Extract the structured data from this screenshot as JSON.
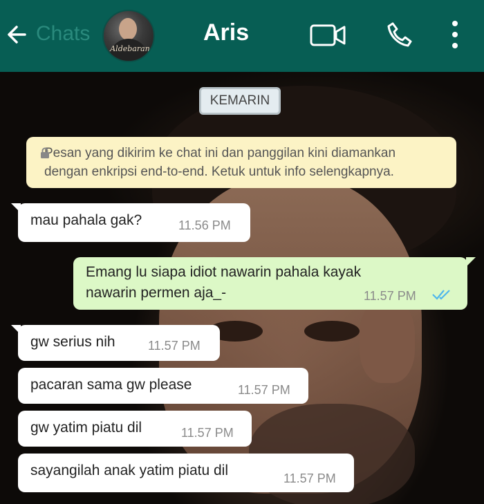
{
  "header": {
    "back_label": "Chats",
    "contact_name": "Aris",
    "avatar_caption": "Aldebaran",
    "icons": [
      "back-arrow-icon",
      "video-call-icon",
      "phone-icon",
      "more-options-icon"
    ]
  },
  "chat": {
    "date_separator": "KEMARIN",
    "encryption_notice": {
      "line1": "Pesan yang dikirim ke chat ini dan panggilan kini diamankan",
      "line2": "dengan enkripsi end-to-end. Ketuk untuk info selengkapnya."
    },
    "messages": [
      {
        "direction": "in",
        "text": "mau pahala gak?",
        "time": "11.56 PM"
      },
      {
        "direction": "out",
        "text_line1": "Emang lu siapa idiot nawarin pahala kayak",
        "text_line2": "nawarin permen aja_-",
        "time": "11.57 PM",
        "status": "read"
      },
      {
        "direction": "in",
        "text": "gw serius nih",
        "time": "11.57 PM"
      },
      {
        "direction": "in",
        "text": "pacaran sama gw please",
        "time": "11.57 PM"
      },
      {
        "direction": "in",
        "text": "gw yatim piatu dil",
        "time": "11.57 PM"
      },
      {
        "direction": "in",
        "text": "sayangilah anak yatim piatu dil",
        "time": "11.57 PM"
      }
    ]
  },
  "colors": {
    "header": "#075e54",
    "outgoing_bubble": "#dcf8c6",
    "incoming_bubble": "#ffffff",
    "notice_bg": "#fcf3c5",
    "read_ticks": "#4fb6ec"
  }
}
